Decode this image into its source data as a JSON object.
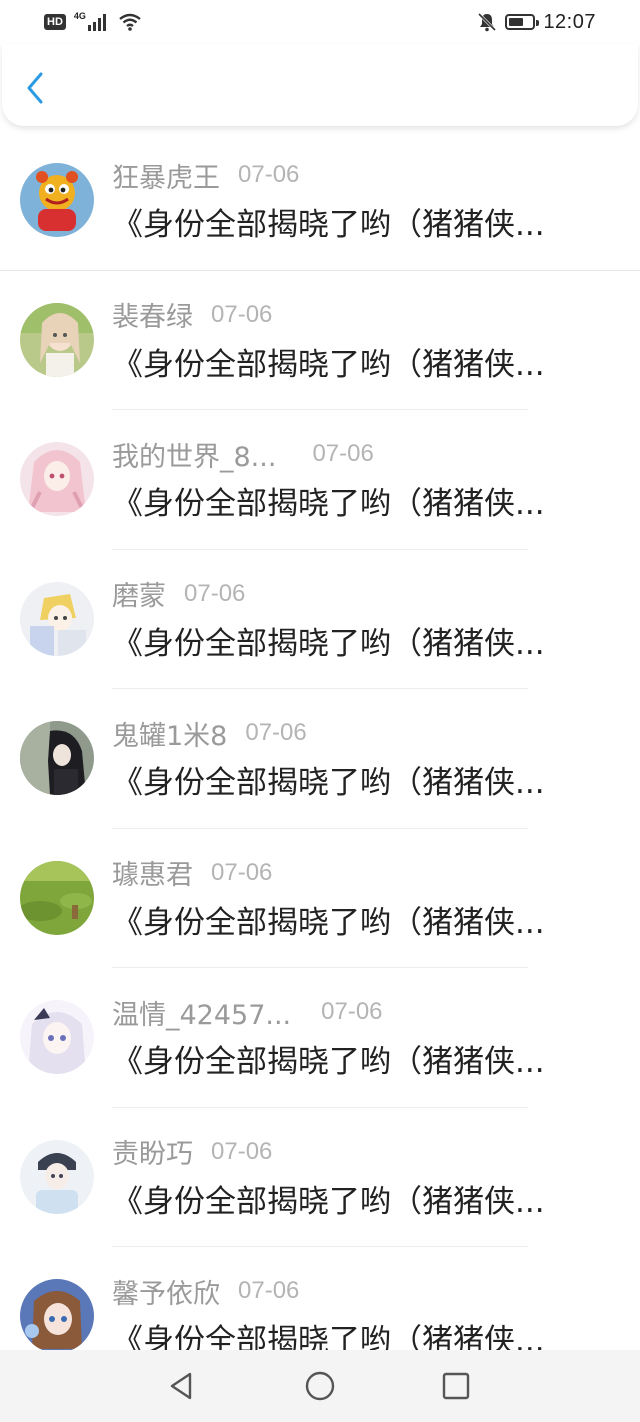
{
  "status_bar": {
    "hd": "HD",
    "network": "4G",
    "time": "12:07",
    "icons": [
      "signal-icon",
      "wifi-icon",
      "mute-bell-icon",
      "battery-icon"
    ]
  },
  "header": {
    "back_icon": "chevron-left-icon",
    "accent": "#2a9be0"
  },
  "messages": [
    {
      "username": "狂暴虎王",
      "date": "07-06",
      "text": "《身份全部揭晓了哟（猪猪侠..."
    },
    {
      "username": "裴春绿",
      "date": "07-06",
      "text": "《身份全部揭晓了哟（猪猪侠..."
    },
    {
      "username": "我的世界_8...",
      "date": "07-06",
      "text": "《身份全部揭晓了哟（猪猪侠..."
    },
    {
      "username": "磨蒙",
      "date": "07-06",
      "text": "《身份全部揭晓了哟（猪猪侠..."
    },
    {
      "username": "鬼罐1米8",
      "date": "07-06",
      "text": "《身份全部揭晓了哟（猪猪侠..."
    },
    {
      "username": "璩惠君",
      "date": "07-06",
      "text": "《身份全部揭晓了哟（猪猪侠..."
    },
    {
      "username": "温情_42457...",
      "date": "07-06",
      "text": "《身份全部揭晓了哟（猪猪侠..."
    },
    {
      "username": "责盼巧",
      "date": "07-06",
      "text": "《身份全部揭晓了哟（猪猪侠..."
    },
    {
      "username": "馨予依欣",
      "date": "07-06",
      "text": "《身份全部揭晓了哟（猪猪侠..."
    }
  ],
  "nav_bar": {
    "icons": [
      "back-triangle-icon",
      "home-circle-icon",
      "recents-square-icon"
    ]
  }
}
